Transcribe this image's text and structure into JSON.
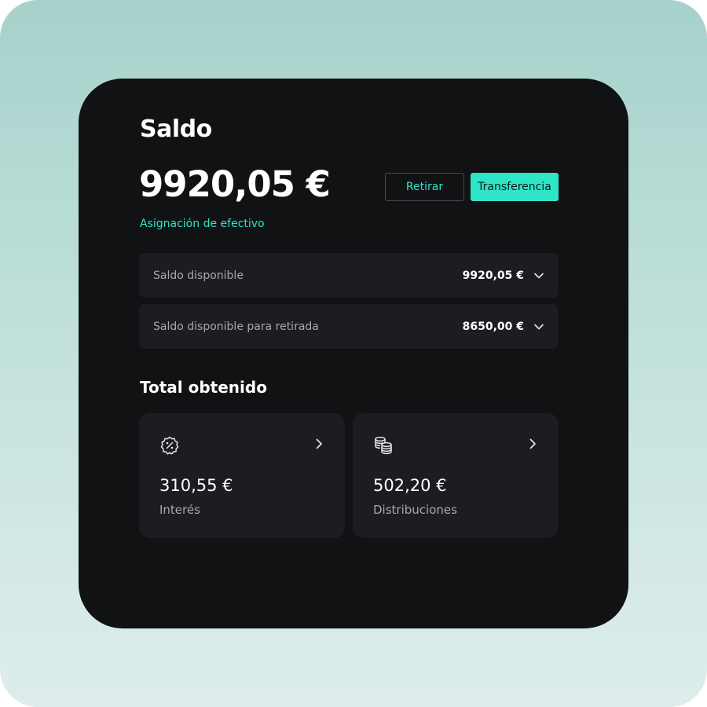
{
  "balance": {
    "title": "Saldo",
    "amount": "9920,05 €",
    "withdraw_label": "Retirar",
    "transfer_label": "Transferencia",
    "allocation_link": "Asignación de efectivo"
  },
  "rows": [
    {
      "label": "Saldo disponible",
      "value": "9920,05 €"
    },
    {
      "label": "Saldo disponible para retirada",
      "value": "8650,00 €"
    }
  ],
  "earned": {
    "title": "Total obtenido",
    "tiles": [
      {
        "amount": "310,55 €",
        "label": "Interés",
        "icon": "percent-badge-icon"
      },
      {
        "amount": "502,20 €",
        "label": "Distribuciones",
        "icon": "coins-stack-icon"
      }
    ]
  },
  "colors": {
    "accent": "#2ee5c8",
    "card_background": "#111214",
    "panel_background": "#1c1d20",
    "muted_text": "#a6a8ab"
  }
}
